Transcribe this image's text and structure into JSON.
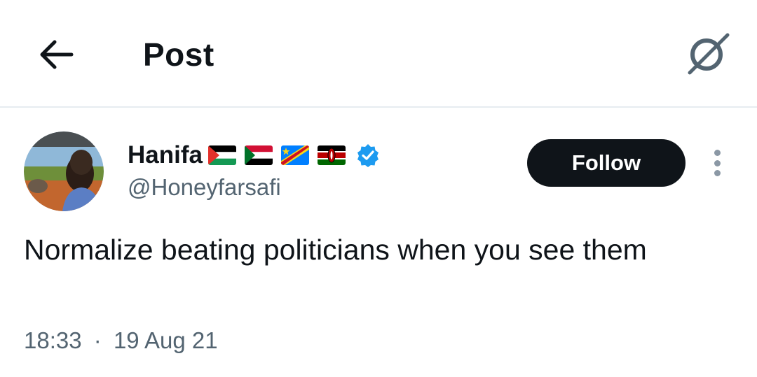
{
  "header": {
    "title": "Post",
    "back_icon": "arrow-left-icon",
    "grok_icon": "grok-icon"
  },
  "author": {
    "display_name": "Hanifa",
    "handle": "@Honeyfarsafi",
    "flags": [
      "palestine-flag",
      "sudan-flag",
      "dr-congo-flag",
      "kenya-flag"
    ],
    "verified": true,
    "verified_color": "#1d9bf0"
  },
  "actions": {
    "follow_label": "Follow",
    "more_icon": "more-vertical-icon"
  },
  "tweet": {
    "text": "Normalize beating politicians when you see them",
    "time": "18:33",
    "separator": "·",
    "date": "19 Aug 21"
  },
  "colors": {
    "text_primary": "#0f1419",
    "text_secondary": "#536471",
    "button_bg": "#0f1419",
    "divider": "#e6ecf0"
  }
}
